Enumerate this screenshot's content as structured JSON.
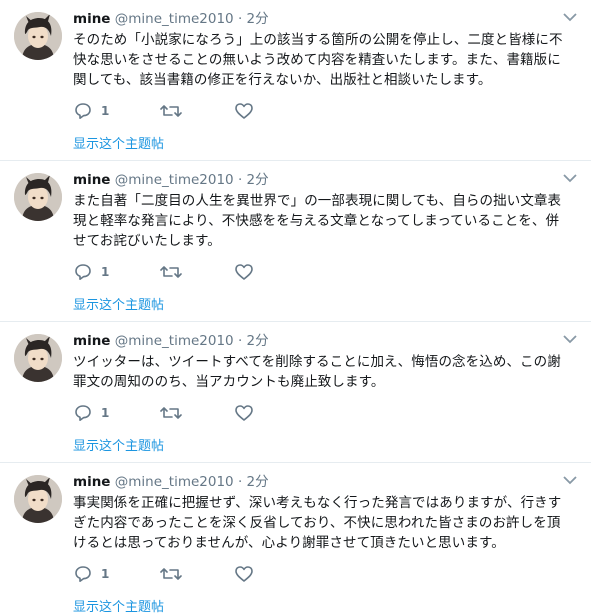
{
  "colors": {
    "link": "#1b95e0",
    "muted": "#657786",
    "divider": "#e6ecf0"
  },
  "icons": {
    "reply": "speech-bubble-icon",
    "retweet": "retweet-arrows-icon",
    "like": "heart-icon",
    "menu": "chevron-down-icon"
  },
  "tweets": [
    {
      "name": "mine",
      "handle": "@mine_time2010",
      "dot": "·",
      "time": "2分",
      "text": "そのため「小説家になろう」上の該当する箇所の公開を停止し、二度と皆様に不\n快な思いをさせることの無いよう改めて内容を精査いたします。また、書籍版に\n関しても、該当書籍の修正を行えないか、出版社と相談いたします。",
      "reply_count": "1",
      "show_thread": "显示这个主题帖"
    },
    {
      "name": "mine",
      "handle": "@mine_time2010",
      "dot": "·",
      "time": "2分",
      "text": "また自著「二度目の人生を異世界で」の一部表現に関しても、自らの拙い文章表\n現と軽率な発言により、不快感をを与える文章となってしまっていることを、併\nせてお詫びいたします。",
      "reply_count": "1",
      "show_thread": "显示这个主题帖"
    },
    {
      "name": "mine",
      "handle": "@mine_time2010",
      "dot": "·",
      "time": "2分",
      "text": "ツイッターは、ツイートすべてを削除することに加え、悔悟の念を込め、この謝\n罪文の周知ののち、当アカウントも廃止致します。",
      "reply_count": "1",
      "show_thread": "显示这个主题帖"
    },
    {
      "name": "mine",
      "handle": "@mine_time2010",
      "dot": "·",
      "time": "2分",
      "text": "事実関係を正確に把握せず、深い考えもなく行った発言ではありますが、行きす\nぎた内容であったことを深く反省しており、不快に思われた皆さまのお許しを頂\nけるとは思っておりませんが、心より謝罪させて頂きたいと思います。",
      "reply_count": "1",
      "show_thread": "显示这个主题帖"
    }
  ]
}
